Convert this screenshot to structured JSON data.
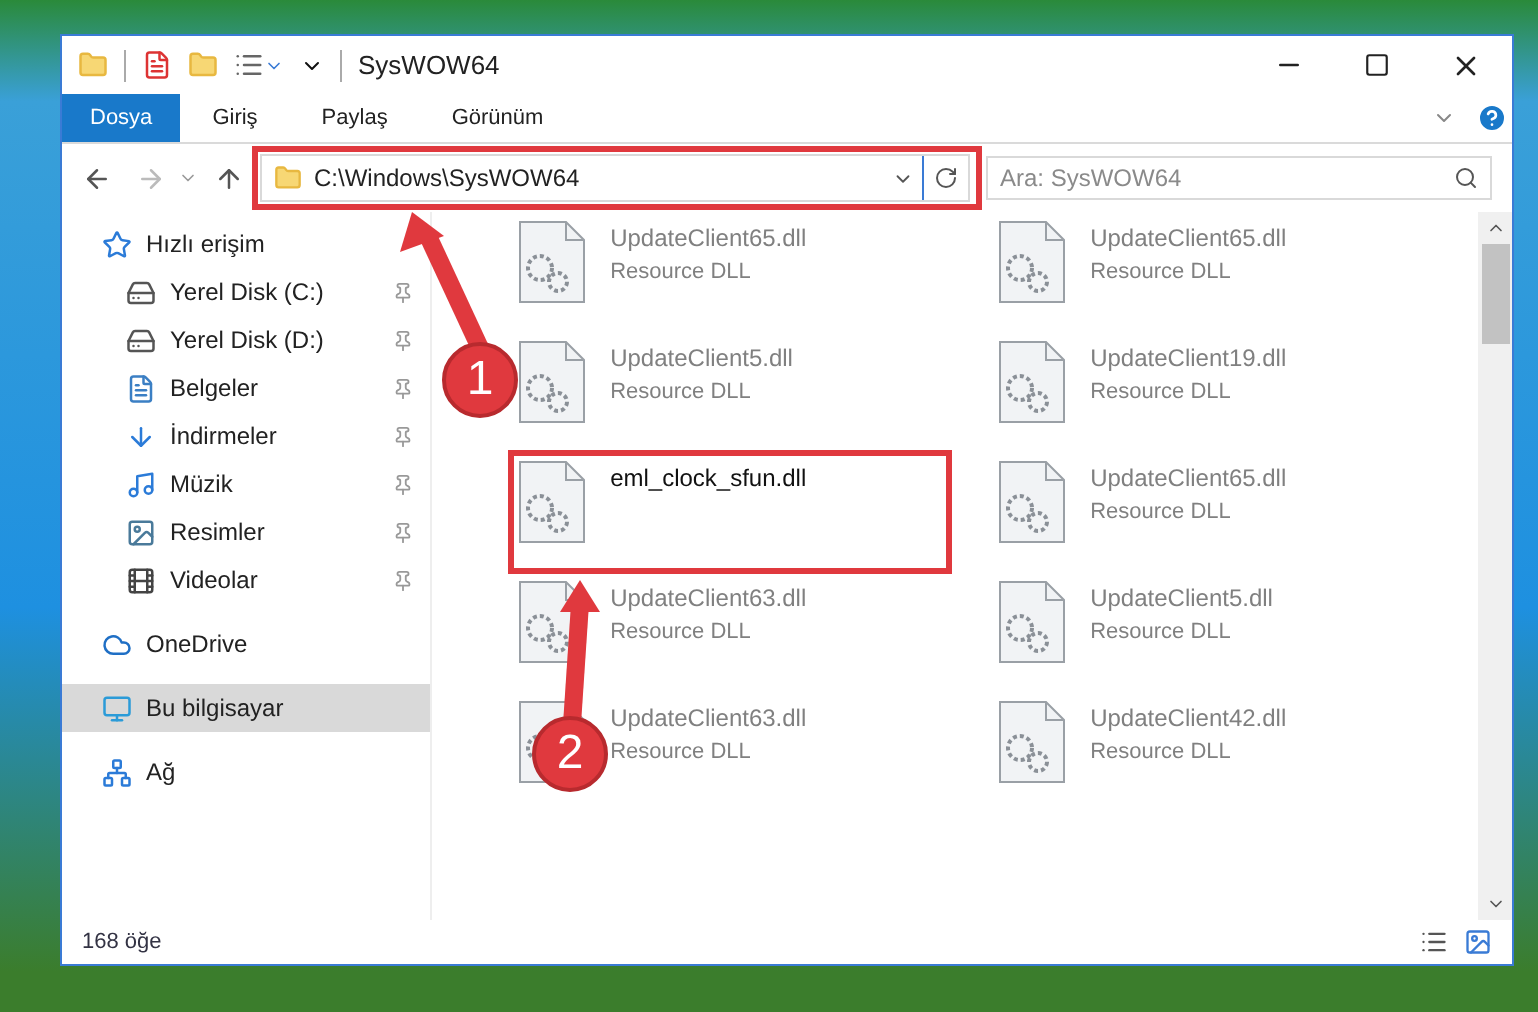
{
  "window": {
    "title": "SysWOW64"
  },
  "ribbon_tabs": [
    {
      "label": "Dosya",
      "selected": true
    },
    {
      "label": "Giriş",
      "selected": false
    },
    {
      "label": "Paylaş",
      "selected": false
    },
    {
      "label": "Görünüm",
      "selected": false
    }
  ],
  "address_bar": {
    "path": "C:\\Windows\\SysWOW64"
  },
  "search": {
    "placeholder": "Ara: SysWOW64"
  },
  "sidebar": {
    "items": [
      {
        "label": "Hızlı erişim",
        "kind": "star",
        "selected": false,
        "children": [
          {
            "label": "Yerel Disk (C:)",
            "kind": "drive",
            "pinned": true
          },
          {
            "label": "Yerel Disk (D:)",
            "kind": "drive",
            "pinned": true
          },
          {
            "label": "Belgeler",
            "kind": "docs",
            "pinned": true
          },
          {
            "label": "İndirmeler",
            "kind": "download",
            "pinned": true
          },
          {
            "label": "Müzik",
            "kind": "music",
            "pinned": true
          },
          {
            "label": "Resimler",
            "kind": "pictures",
            "pinned": true
          },
          {
            "label": "Videolar",
            "kind": "video",
            "pinned": true
          }
        ]
      },
      {
        "label": "OneDrive",
        "kind": "cloud",
        "selected": false
      },
      {
        "label": "Bu bilgisayar",
        "kind": "computer",
        "selected": true
      },
      {
        "label": "Ağ",
        "kind": "network",
        "selected": false
      }
    ]
  },
  "files": [
    {
      "name": "UpdateClient65.dll",
      "type": "Resource DLL",
      "faded": true
    },
    {
      "name": "UpdateClient65.dll",
      "type": "Resource DLL",
      "faded": true
    },
    {
      "name": "UpdateClient5.dll",
      "type": "Resource DLL",
      "faded": true
    },
    {
      "name": "UpdateClient19.dll",
      "type": "Resource DLL",
      "faded": true
    },
    {
      "name": "eml_clock_sfun.dll",
      "faded": false
    },
    {
      "name": "UpdateClient65.dll",
      "type": "Resource DLL",
      "faded": true
    },
    {
      "name": "UpdateClient63.dll",
      "type": "Resource DLL",
      "faded": true
    },
    {
      "name": "UpdateClient5.dll",
      "type": "Resource DLL",
      "faded": true
    },
    {
      "name": "UpdateClient63.dll",
      "type": "Resource DLL",
      "faded": true
    },
    {
      "name": "UpdateClient42.dll",
      "type": "Resource DLL",
      "faded": true
    }
  ],
  "status_bar": {
    "count": "168 öğe"
  },
  "annotations": [
    {
      "label": "1"
    },
    {
      "label": "2"
    }
  ]
}
